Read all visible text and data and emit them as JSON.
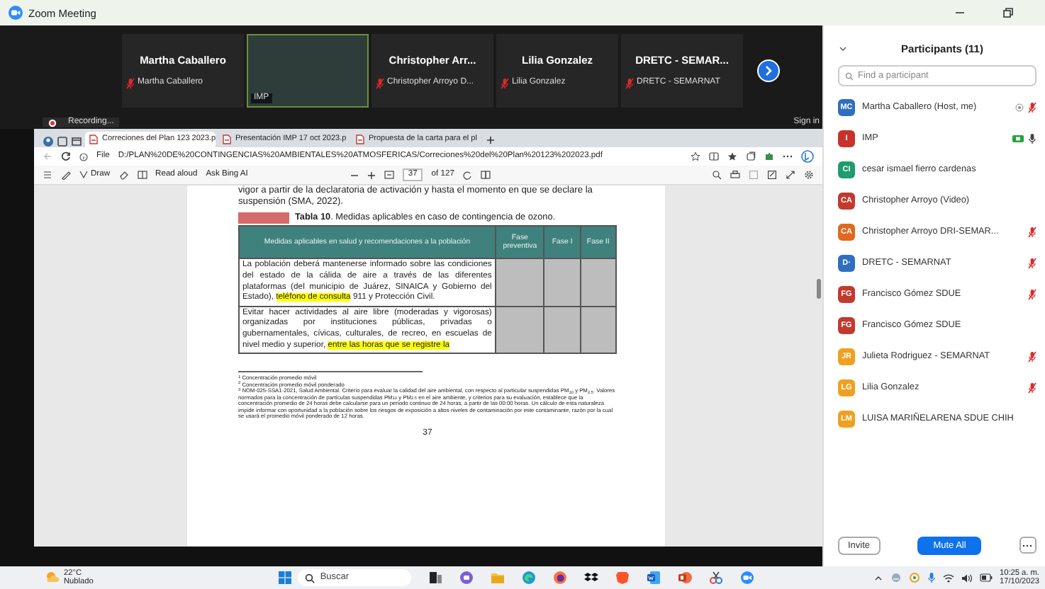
{
  "window": {
    "title": "Zoom Meeting"
  },
  "video_strip": {
    "tiles": [
      {
        "kind": "name",
        "display_name": "Martha Caballero",
        "label": "Martha Caballero",
        "muted": true
      },
      {
        "kind": "video",
        "label": "IMP",
        "muted": false
      },
      {
        "kind": "name",
        "display_name": "Christopher  Arr...",
        "label": "Christopher Arroyo D...",
        "muted": true
      },
      {
        "kind": "name",
        "display_name": "Lilia Gonzalez",
        "label": "Lilia Gonzalez",
        "muted": true
      },
      {
        "kind": "name",
        "display_name": "DRETC - SEMAR...",
        "label": "DRETC - SEMARNAT",
        "muted": true
      }
    ],
    "recording": "Recording...",
    "sign_in": "Sign in"
  },
  "browser": {
    "tabs": [
      {
        "title": "Correciones del Plan 123 2023.p",
        "selected": true
      },
      {
        "title": "Presentación IMP 17 oct 2023.p",
        "selected": false
      },
      {
        "title": "Propuesta de la carta para el pl",
        "selected": false
      }
    ],
    "address_prefix": "File",
    "address": "D:/PLAN%20DE%20CONTINGENCIAS%20AMBIENTALES%20ATMOSFERICAS/Correciones%20del%20Plan%20123%202023.pdf",
    "toolbar": {
      "draw": "Draw",
      "read_aloud": "Read aloud",
      "ask": "Ask Bing AI",
      "page": "37",
      "page_total": "of 127"
    }
  },
  "document": {
    "paragraph": "vigor a partir de la declaratoria de activación y hasta el momento en que se declare la suspensión (SMA, 2022).",
    "table_caption": "**Tabla 10**. Medidas aplicables en caso de contingencia de ozono.",
    "table": {
      "columns": [
        "Medidas aplicables en salud y recomendaciones a la población",
        "Fase preventiva",
        "Fase I",
        "Fase II"
      ],
      "rows": [
        {
          "segments": [
            {
              "text": "La población deberá mantenerse informado sobre las condiciones del estado de la cálida de aire a través de las diferentes plataformas (del municipio de Juárez, SINAICA y Gobierno del Estado), ",
              "highlight": false
            },
            {
              "text": "teléfono de consulta",
              "highlight": true
            },
            {
              "text": " 911 y Protección Civil.",
              "highlight": false
            }
          ]
        },
        {
          "segments": [
            {
              "text": "Evitar hacer actividades al aire libre (moderadas y vigorosas) organizadas por instituciones públicas, privadas o gubernamentales, cívicas, culturales, de recreo, en escuelas de nivel medio y superior, ",
              "highlight": false
            },
            {
              "text": "entre las horas que se registre la",
              "highlight": true
            }
          ]
        }
      ]
    },
    "footnotes": [
      "$^{1}$ Concentración promedio móvil",
      "$^{2}$ Concentración promedio móvil ponderado",
      "$^{3}$ NOM-025-SSA1-2021, Salud Ambiental. Criterio para evaluar la calidad del aire ambiental, con respecto al particular suspendidas PM$_{10}$ y PM$_{2.5}$. Valores normados para la concentración de partículas suspendidas PM$_{10}$ y PM$_{2.5}$ en el aire ambiente, y criterios para su evaluación, establece que la concentración promedio de 24 horas debe calcularse para un periodo continuo de 24 horas, a partir de las 00:00 horas. Un cálculo de esta naturaleza impide informar con oportunidad a la población sobre los riesgos de exposición a altos niveles de contaminación por este contaminante, razón por la cual se usará el promedio móvil ponderado de 12 horas."
    ],
    "page_number": "37"
  },
  "participants": {
    "title": "Participants (11)",
    "search": {
      "placeholder": "Find a participant"
    },
    "items": [
      {
        "initials": "MC",
        "color": "#2f6fc0",
        "name": "Martha Caballero (Host, me)",
        "muted": true,
        "mic_on": false,
        "video": false,
        "recording": true
      },
      {
        "initials": "I",
        "color": "#c8322c",
        "name": "IMP",
        "muted": false,
        "mic_on": true,
        "video": true,
        "recording": false
      },
      {
        "initials": "CI",
        "color": "#1f9b6e",
        "name": "cesar ismael fierro cardenas",
        "muted": false,
        "mic_on": false,
        "video": false,
        "recording": false
      },
      {
        "initials": "CA",
        "color": "#c23a2e",
        "name": "Christopher Arroyo (Video)",
        "muted": false,
        "mic_on": false,
        "video": false,
        "recording": false
      },
      {
        "initials": "CA",
        "color": "#e0691f",
        "name": "Christopher Arroyo DRI-SEMAR...",
        "muted": true,
        "mic_on": false,
        "video": false,
        "recording": false
      },
      {
        "initials": "D·",
        "color": "#2f6fc0",
        "name": "DRETC - SEMARNAT",
        "muted": true,
        "mic_on": false,
        "video": false,
        "recording": false
      },
      {
        "initials": "FG",
        "color": "#c23a2e",
        "name": "Francisco Gómez SDUE",
        "muted": true,
        "mic_on": false,
        "video": false,
        "recording": false
      },
      {
        "initials": "FG",
        "color": "#c23a2e",
        "name": "Francisco Gómez SDUE",
        "muted": false,
        "mic_on": false,
        "video": false,
        "recording": false
      },
      {
        "initials": "JR",
        "color": "#f0a020",
        "name": "Julieta Rodriguez - SEMARNAT",
        "muted": true,
        "mic_on": false,
        "video": false,
        "recording": false
      },
      {
        "initials": "LG",
        "color": "#f0a020",
        "name": "Lilia Gonzalez",
        "muted": true,
        "mic_on": false,
        "video": false,
        "recording": false
      },
      {
        "initials": "LM",
        "color": "#f0a020",
        "name": "LUISA MARIÑELARENA SDUE CHIH",
        "muted": false,
        "mic_on": false,
        "video": false,
        "recording": false
      }
    ],
    "buttons": [
      {
        "kind": "outline",
        "label": "Invite"
      },
      {
        "kind": "primary",
        "label": "Mute All"
      }
    ]
  },
  "taskbar": {
    "temperature": "22°C",
    "condition": "Nublado",
    "search_placeholder": "Buscar",
    "time": "10:25 a. m.",
    "date": "17/10/2023"
  }
}
